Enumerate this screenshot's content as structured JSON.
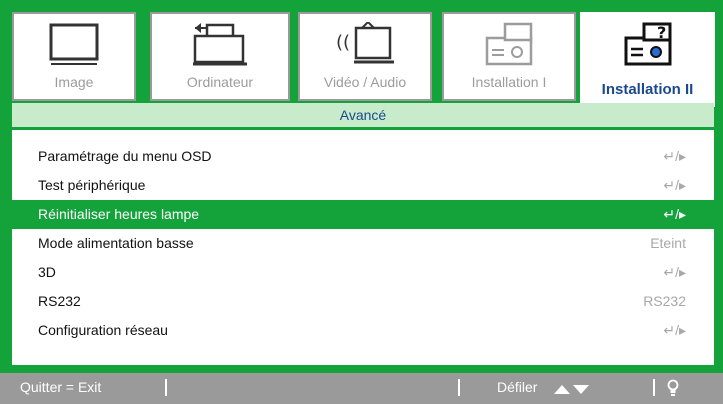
{
  "tabs": [
    {
      "label": "Image",
      "icon": "monitor-icon",
      "active": false
    },
    {
      "label": "Ordinateur",
      "icon": "computer-icon",
      "active": false
    },
    {
      "label": "Vidéo / Audio",
      "icon": "video-audio-icon",
      "active": false
    },
    {
      "label": "Installation I",
      "icon": "projector-icon",
      "active": false
    },
    {
      "label": "Installation II",
      "icon": "projector-question-icon",
      "active": true
    }
  ],
  "panel": {
    "title": "Avancé",
    "rows": [
      {
        "label": "Paramétrage du menu OSD",
        "value": "↵/▸",
        "value_type": "enter-icon",
        "selected": false
      },
      {
        "label": "Test périphérique",
        "value": "↵/▸",
        "value_type": "enter-icon",
        "selected": false
      },
      {
        "label": "Réinitialiser heures lampe",
        "value": "↵/▸",
        "value_type": "enter-icon",
        "selected": true
      },
      {
        "label": "Mode alimentation basse",
        "value": "Eteint",
        "value_type": "text",
        "selected": false
      },
      {
        "label": "3D",
        "value": "↵/▸",
        "value_type": "enter-icon",
        "selected": false
      },
      {
        "label": "RS232",
        "value": "RS232",
        "value_type": "text",
        "selected": false
      },
      {
        "label": "Configuration réseau",
        "value": "↵/▸",
        "value_type": "enter-icon",
        "selected": false
      }
    ]
  },
  "statusbar": {
    "quit": "Quitter = Exit",
    "scroll": "Défiler",
    "scroll_icon": "up-down-arrows-icon",
    "help_icon": "lightbulb-icon"
  },
  "colors": {
    "frame_green": "#14a33b",
    "header_bg": "#c8eccb",
    "active_tab_text": "#1b4a8c",
    "inactive_text": "#9c9c9c",
    "statusbar_bg": "#9a9a9a"
  }
}
